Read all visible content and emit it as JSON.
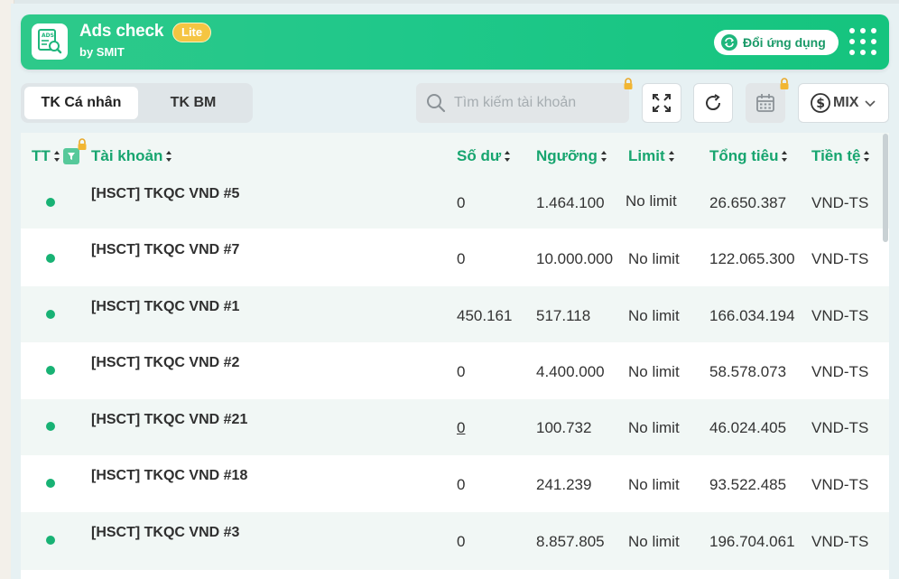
{
  "header": {
    "app_title": "Ads check",
    "badge": "Lite",
    "subtitle": "by SMIT",
    "switch_label": "Đổi ứng dụng",
    "logo_text": "ADS"
  },
  "tabs": [
    {
      "label": "TK Cá nhân",
      "active": true
    },
    {
      "label": "TK BM",
      "active": false
    }
  ],
  "search": {
    "placeholder": "Tìm kiếm tài khoản"
  },
  "currency_select": {
    "value": "MIX"
  },
  "columns": {
    "status": "TT",
    "account": "Tài khoản",
    "balance": "Số dư",
    "threshold": "Ngưỡng",
    "limit": "Limit",
    "total_spend": "Tổng tiêu",
    "currency": "Tiền tệ"
  },
  "rows": [
    {
      "account": "[HSCT] TKQC VND #5",
      "balance": "0",
      "threshold": "1.464.100",
      "limit": "No limit",
      "total_spend": "26.650.387",
      "currency": "VND-TS"
    },
    {
      "account": "[HSCT] TKQC VND #7",
      "balance": "0",
      "threshold": "10.000.000",
      "limit": "No limit",
      "total_spend": "122.065.300",
      "currency": "VND-TS"
    },
    {
      "account": "[HSCT] TKQC VND #1",
      "balance": "450.161",
      "threshold": "517.118",
      "limit": "No limit",
      "total_spend": "166.034.194",
      "currency": "VND-TS"
    },
    {
      "account": "[HSCT] TKQC VND #2",
      "balance": "0",
      "threshold": "4.400.000",
      "limit": "No limit",
      "total_spend": "58.578.073",
      "currency": "VND-TS"
    },
    {
      "account": "[HSCT] TKQC VND #21",
      "balance": "0",
      "threshold": "100.732",
      "limit": "No limit",
      "total_spend": "46.024.405",
      "currency": "VND-TS"
    },
    {
      "account": "[HSCT] TKQC VND #18",
      "balance": "0",
      "threshold": "241.239",
      "limit": "No limit",
      "total_spend": "93.522.485",
      "currency": "VND-TS"
    },
    {
      "account": "[HSCT] TKQC VND #3",
      "balance": "0",
      "threshold": "8.857.805",
      "limit": "No limit",
      "total_spend": "196.704.061",
      "currency": "VND-TS"
    }
  ],
  "colors": {
    "accent": "#17a56f",
    "header_gradient": "#1fc88a",
    "status_dot": "#18b274",
    "badge": "#f5c542"
  }
}
